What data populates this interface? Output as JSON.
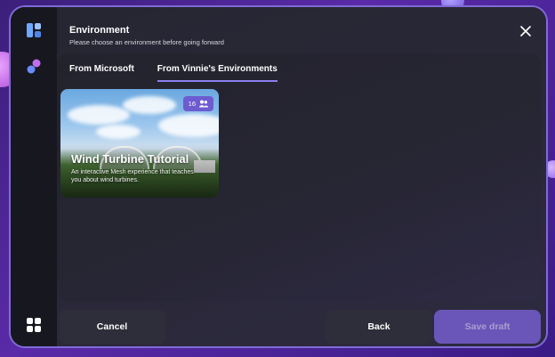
{
  "dialog": {
    "title": "Environment",
    "subtitle": "Please choose an environment before going forward"
  },
  "tabs": [
    {
      "label": "From Microsoft",
      "active": false
    },
    {
      "label": "From Vinnie's Environments",
      "active": true
    }
  ],
  "environment_card": {
    "title": "Wind Turbine Tutorial",
    "description": "An interactive Mesh experience that teaches you about wind turbines.",
    "capacity": "16",
    "capacity_icon": "people-icon"
  },
  "buttons": {
    "cancel": "Cancel",
    "back": "Back",
    "save_draft": "Save draft"
  },
  "icons": {
    "rail_top": "panels-icon",
    "rail_mid": "mesh-icon",
    "rail_bottom": "apps-grid-icon",
    "close": "close-icon"
  },
  "colors": {
    "accent": "#8b7ff0",
    "badge": "#6d5bd0",
    "primary_button": "#6a55b8"
  }
}
